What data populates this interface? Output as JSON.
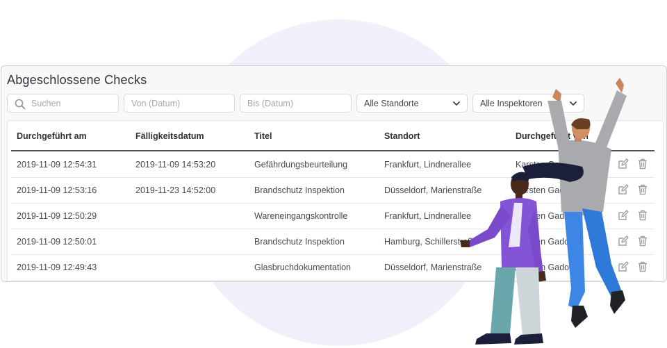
{
  "page": {
    "title": "Abgeschlossene Checks"
  },
  "filters": {
    "search_placeholder": "Suchen",
    "from_placeholder": "Von (Datum)",
    "to_placeholder": "Bis (Datum)",
    "location_selected": "Alle Standorte",
    "inspector_selected": "Alle Inspektoren"
  },
  "table": {
    "headers": [
      "Durchgeführt am",
      "Fälligkeitsdatum",
      "Titel",
      "Standort",
      "Durchgeführt von"
    ],
    "rows": [
      {
        "performed": "2019-11-09 12:54:31",
        "due": "2019-11-09 14:53:20",
        "title": "Gefährdungsbeurteilung",
        "location": "Frankfurt, Lindnerallee",
        "by": "Karsten Gado"
      },
      {
        "performed": "2019-11-09 12:53:16",
        "due": "2019-11-23 14:52:00",
        "title": "Brandschutz Inspektion",
        "location": "Düsseldorf, Marienstraße",
        "by": "Karsten Gado"
      },
      {
        "performed": "2019-11-09 12:50:29",
        "due": "",
        "title": "Wareneingangskontrolle",
        "location": "Frankfurt, Lindnerallee",
        "by": "Karsten Gado"
      },
      {
        "performed": "2019-11-09 12:50:01",
        "due": "",
        "title": "Brandschutz Inspektion",
        "location": "Hamburg, Schillerstraße",
        "by": "Karsten Gado"
      },
      {
        "performed": "2019-11-09 12:49:43",
        "due": "",
        "title": "Glasbruchdokumentation",
        "location": "Düsseldorf, Marienstraße",
        "by": "Karsten Gado"
      }
    ],
    "actions": {
      "edit_icon": "edit-icon",
      "delete_icon": "trash-icon"
    }
  },
  "colors": {
    "background_blob": "#f2effa",
    "border": "#cfd2d6",
    "header_rule": "#4a5056",
    "icon_gray": "#9aa0a6"
  },
  "illustration": {
    "subject": "two-people-celebrating"
  }
}
